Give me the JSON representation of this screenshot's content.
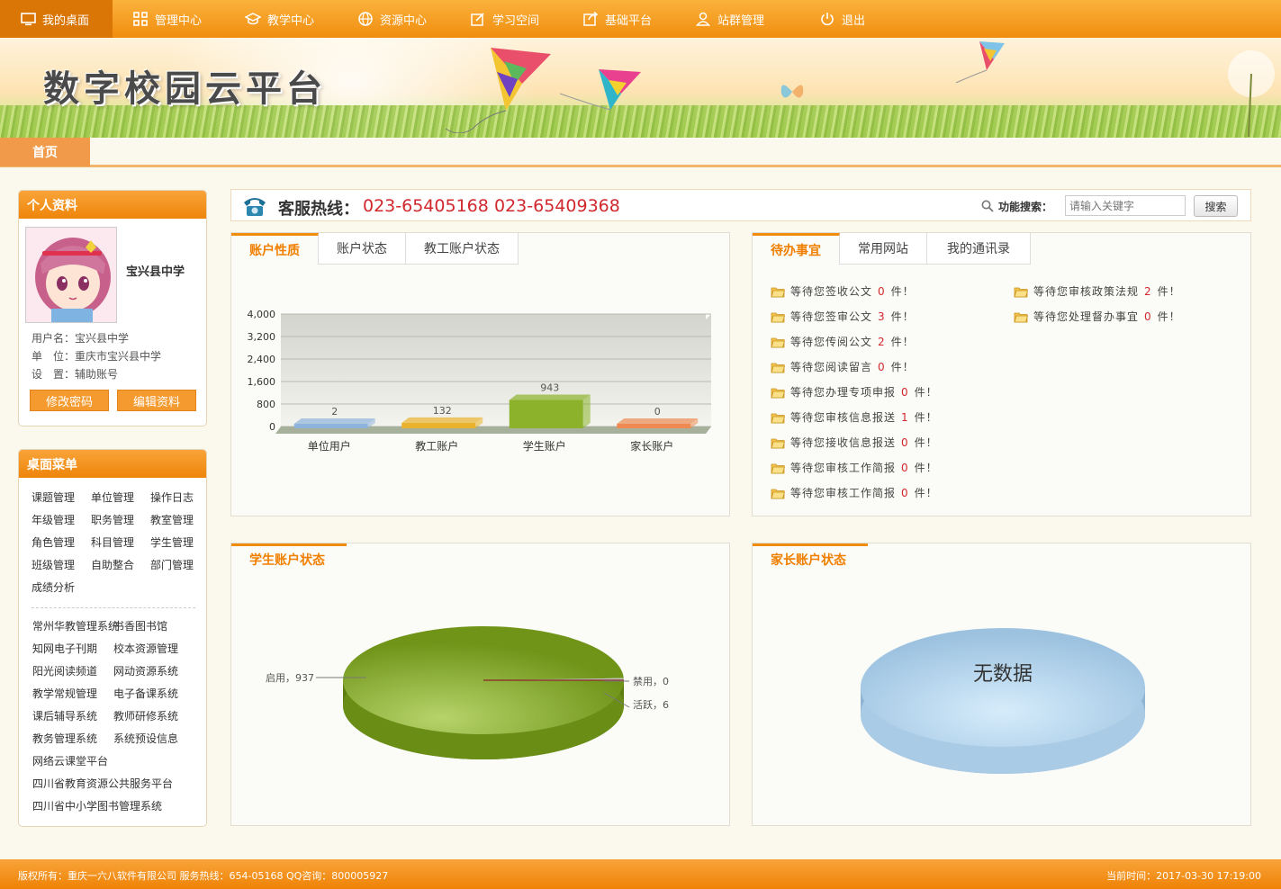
{
  "nav": [
    {
      "label": "我的桌面",
      "icon": "monitor-icon"
    },
    {
      "label": "管理中心",
      "icon": "grid-icon"
    },
    {
      "label": "教学中心",
      "icon": "graduation-cap-icon"
    },
    {
      "label": "资源中心",
      "icon": "globe-icon"
    },
    {
      "label": "学习空间",
      "icon": "edit-icon"
    },
    {
      "label": "基础平台",
      "icon": "share-icon"
    },
    {
      "label": "站群管理",
      "icon": "user-icon"
    },
    {
      "label": "退出",
      "icon": "power-icon"
    }
  ],
  "banner": {
    "title": "数字校园云平台"
  },
  "breadcrumb": {
    "home": "首页"
  },
  "profile": {
    "header": "个人资料",
    "school": "宝兴县中学",
    "username": "用户名：宝兴县中学",
    "unit": "单　位：重庆市宝兴县中学",
    "setting": "设　置：辅助账号",
    "btn_password": "修改密码",
    "btn_edit": "编辑资料"
  },
  "menu": {
    "header": "桌面菜单",
    "items": [
      "课题管理",
      "单位管理",
      "操作日志",
      "年级管理",
      "职务管理",
      "教室管理",
      "角色管理",
      "科目管理",
      "学生管理",
      "班级管理",
      "自助整合",
      "部门管理",
      "成绩分析"
    ],
    "links": [
      "常州华教管理系统",
      "书香图书馆",
      "知网电子刊期",
      "校本资源管理",
      "阳光阅读频道",
      "网动资源系统",
      "教学常规管理",
      "电子备课系统",
      "课后辅导系统",
      "教师研修系统",
      "教务管理系统",
      "系统预设信息"
    ],
    "links_full": [
      "网络云课堂平台",
      "四川省教育资源公共服务平台",
      "四川省中小学图书管理系统"
    ]
  },
  "hotline": {
    "label": "客服热线：",
    "phone1": "023-65405168",
    "phone2": "023-65409368",
    "search_label": "功能搜索：",
    "search_placeholder": "请输入关键字",
    "search_button": "搜索"
  },
  "account_box": {
    "tabs": [
      "账户性质",
      "账户状态",
      "教工账户状态"
    ]
  },
  "chart_data": [
    {
      "type": "bar",
      "categories": [
        "单位用户",
        "教工账户",
        "学生账户",
        "家长账户"
      ],
      "values": [
        2,
        132,
        943,
        0
      ],
      "ylim": [
        0,
        4000
      ],
      "yticks": [
        "4,000",
        "3,200",
        "2,400",
        "1,600",
        "800",
        "0"
      ],
      "colors": [
        "#8fb4dc",
        "#e9b22c",
        "#8bb22a",
        "#ee8a52"
      ],
      "grid": true
    },
    {
      "type": "pie",
      "title": "学生账户状态",
      "labels": [
        "启用",
        "禁用",
        "活跃"
      ],
      "values": [
        937,
        0,
        6
      ],
      "slice_labels": [
        "启用，937",
        "禁用，0",
        "活跃，6"
      ],
      "colors": [
        "#7a9c1e",
        "#a0522d",
        "#c0c0c0"
      ]
    },
    {
      "type": "pie",
      "title": "家长账户状态",
      "labels": [],
      "values": [],
      "empty_text": "无数据"
    }
  ],
  "todo_box": {
    "tabs": [
      "待办事宜",
      "常用网站",
      "我的通讯录"
    ],
    "left": [
      {
        "text": "等待您签收公文",
        "count": "0",
        "unit": "件！"
      },
      {
        "text": "等待您签审公文",
        "count": "3",
        "unit": "件！"
      },
      {
        "text": "等待您传阅公文",
        "count": "2",
        "unit": "件！"
      },
      {
        "text": "等待您阅读留言",
        "count": "0",
        "unit": "件！"
      },
      {
        "text": "等待您办理专项申报",
        "count": "0",
        "unit": "件！"
      },
      {
        "text": "等待您审核信息报送",
        "count": "1",
        "unit": "件！"
      },
      {
        "text": "等待您接收信息报送",
        "count": "0",
        "unit": "件！"
      },
      {
        "text": "等待您审核工作简报",
        "count": "0",
        "unit": "件！"
      },
      {
        "text": "等待您审核工作简报",
        "count": "0",
        "unit": "件！"
      }
    ],
    "right": [
      {
        "text": "等待您审核政策法规",
        "count": "2",
        "unit": "件！"
      },
      {
        "text": "等待您处理督办事宜",
        "count": "0",
        "unit": "件！"
      }
    ]
  },
  "footer": {
    "left": "版权所有：重庆一六八软件有限公司 服务热线：654-05168 QQ咨询：800005927",
    "right": "当前时间：2017-03-30 17:19:00"
  }
}
